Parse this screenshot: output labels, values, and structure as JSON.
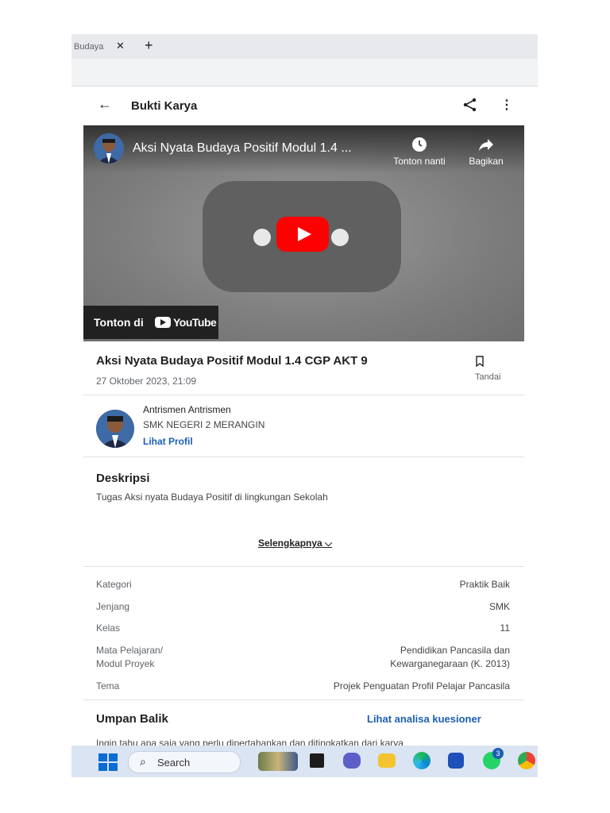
{
  "browser": {
    "tab_label": "Budaya",
    "tab_close": "✕",
    "new_tab": "+"
  },
  "header": {
    "back": "←",
    "title": "Bukti Karya",
    "more": "⋮"
  },
  "video": {
    "title": "Aksi Nyata Budaya Positif Modul 1.4 ...",
    "watch_later": "Tonton nanti",
    "share": "Bagikan",
    "watch_on": "Tonton di",
    "yt_brand": "YouTube"
  },
  "post": {
    "title": "Aksi Nyata Budaya Positif Modul 1.4 CGP AKT 9",
    "date": "27 Oktober 2023, 21:09",
    "bookmark_label": "Tandai"
  },
  "author": {
    "name": "Antrismen Antrismen",
    "school": "SMK NEGERI 2 MERANGIN",
    "profile_link": "Lihat Profil"
  },
  "description": {
    "heading": "Deskripsi",
    "body": "Tugas Aksi nyata Budaya Positif di lingkungan Sekolah",
    "more_link": "Selengkapnya",
    "more_chevron": "⌵"
  },
  "meta": {
    "kategori_label": "Kategori",
    "kategori_value": "Praktik Baik",
    "jenjang_label": "Jenjang",
    "jenjang_value": "SMK",
    "kelas_label": "Kelas",
    "kelas_value": "11",
    "mapel_label_1": "Mata Pelajaran/",
    "mapel_label_2": "Modul Proyek",
    "mapel_value_1": "Pendidikan Pancasila dan",
    "mapel_value_2": "Kewarganegaraan (K. 2013)",
    "tema_label": "Tema",
    "tema_value": "Projek Penguatan Profil Pelajar Pancasila"
  },
  "feedback": {
    "heading": "Umpan Balik",
    "link": "Lihat analisa kuesioner",
    "text": "Ingin tahu apa saja yang perlu dipertahankan dan ditingkatkan dari karya"
  },
  "taskbar": {
    "search_label": "Search",
    "search_icon": "⌕",
    "badge": "3"
  },
  "colors": {
    "accent": "#1a5fb4",
    "youtube_red": "#ff0000"
  }
}
